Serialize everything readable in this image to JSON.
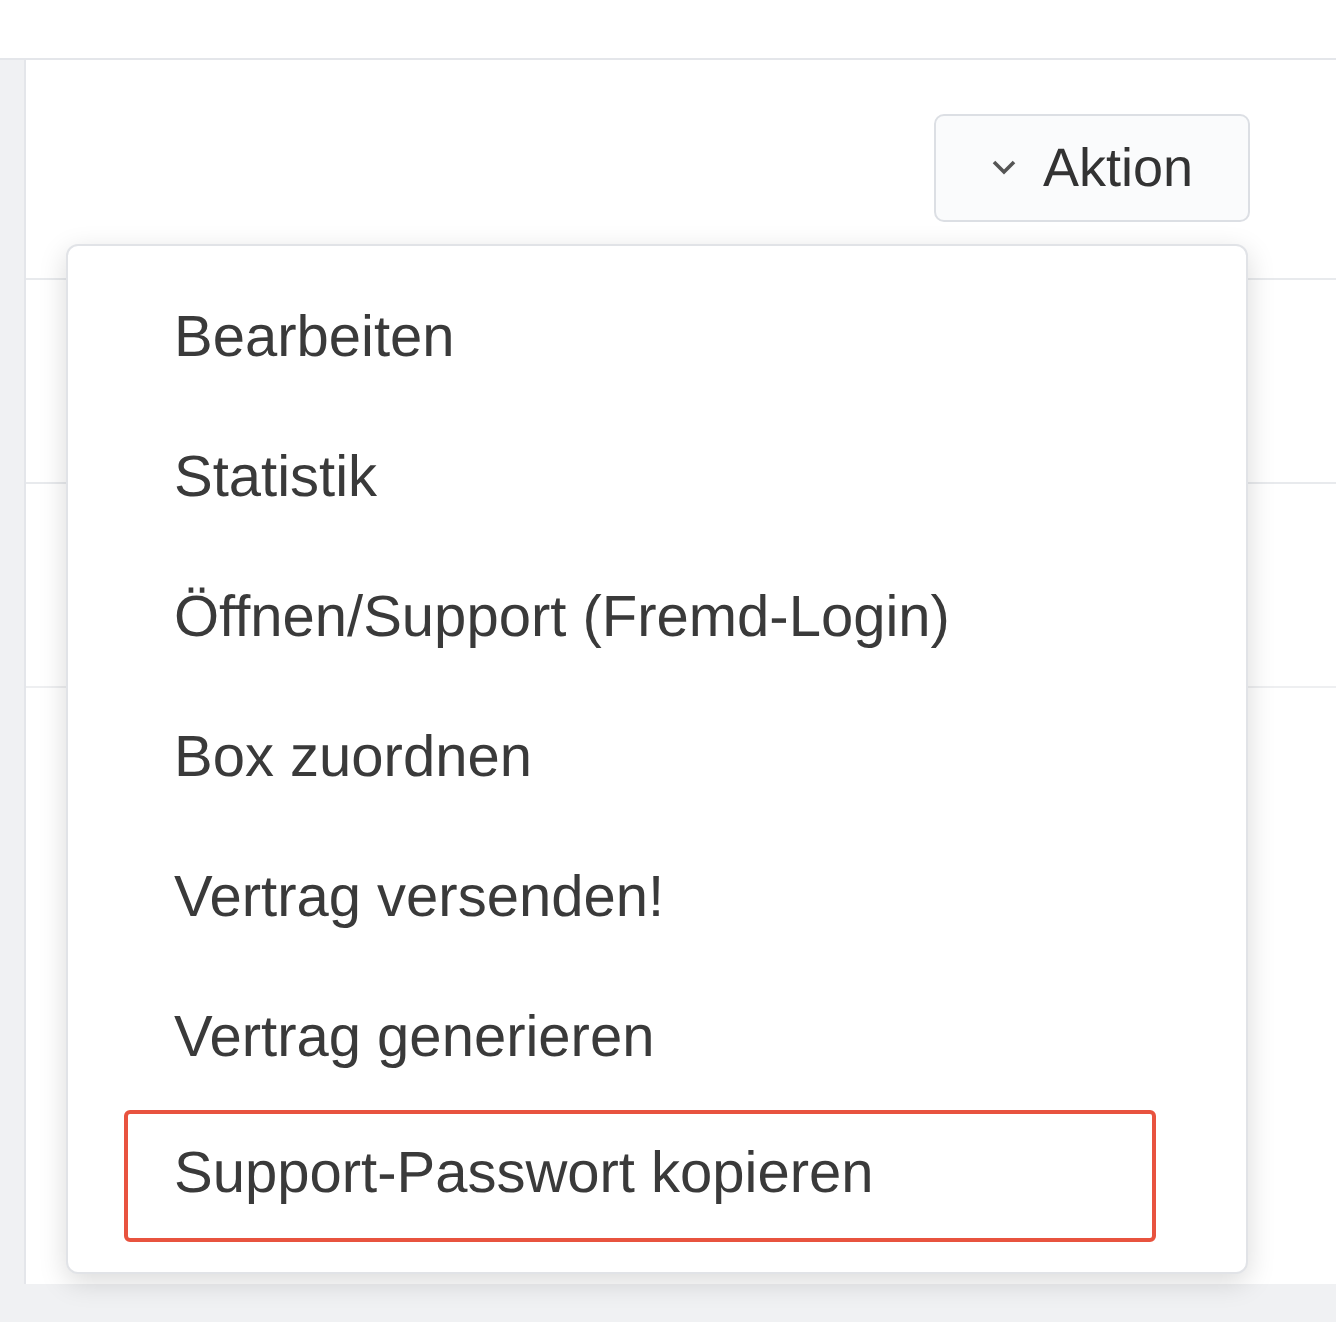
{
  "action_button": {
    "label": "Aktion",
    "expanded": true
  },
  "menu": {
    "items": [
      {
        "label": "Bearbeiten",
        "highlighted": false
      },
      {
        "label": "Statistik",
        "highlighted": false
      },
      {
        "label": "Öffnen/Support (Fremd-Login)",
        "highlighted": false
      },
      {
        "label": "Box zuordnen",
        "highlighted": false
      },
      {
        "label": "Vertrag versenden!",
        "highlighted": false
      },
      {
        "label": "Vertrag generieren",
        "highlighted": false
      },
      {
        "label": "Support-Passwort kopieren",
        "highlighted": true
      }
    ]
  }
}
